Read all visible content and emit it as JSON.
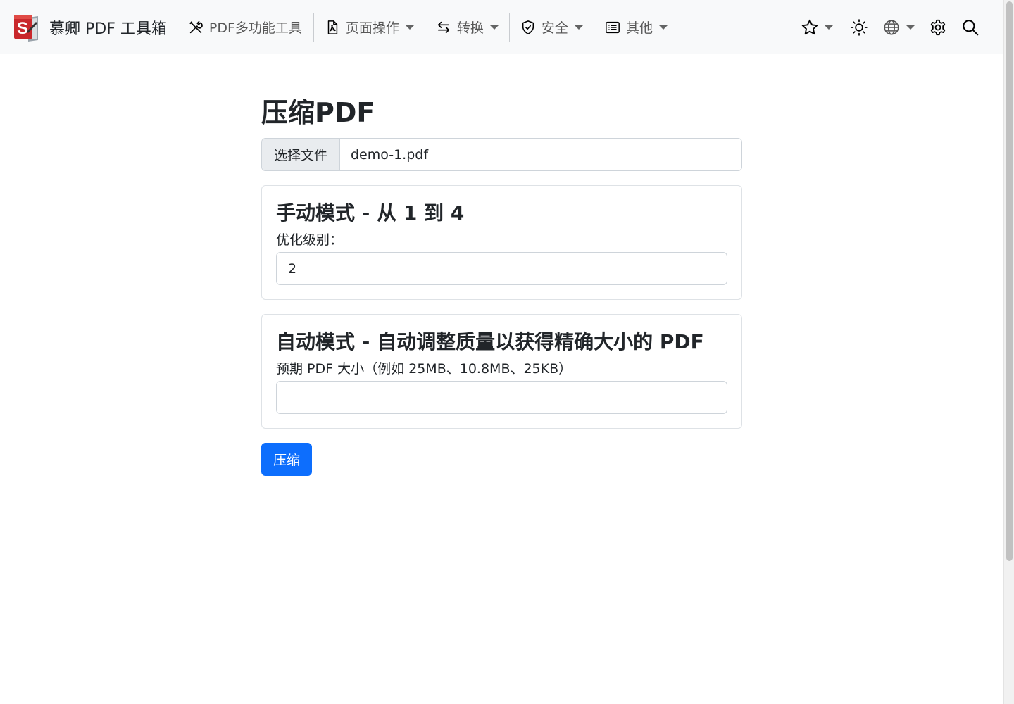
{
  "navbar": {
    "brand_text": "慕卿 PDF 工具箱",
    "multi_tool": "PDF多功能工具",
    "page_ops": "页面操作",
    "convert": "转换",
    "security": "安全",
    "other": "其他",
    "icons": {
      "multi_tool": "tools-icon",
      "page_ops": "file-pdf-icon",
      "convert": "arrows-exchange-icon",
      "security": "shield-icon",
      "other": "list-icon",
      "favorites": "star-icon",
      "theme": "sun-icon",
      "language": "globe-icon",
      "settings": "gear-icon",
      "search": "search-icon"
    }
  },
  "main": {
    "title": "压缩PDF",
    "file_button": "选择文件",
    "file_name": "demo-1.pdf",
    "manual_card": {
      "title": "手动模式 - 从 1 到 4",
      "label": "优化级别：",
      "value": "2"
    },
    "auto_card": {
      "title": "自动模式 - 自动调整质量以获得精确大小的 PDF",
      "label": "预期 PDF 大小（例如 25MB、10.8MB、25KB）",
      "value": ""
    },
    "submit": "压缩"
  },
  "colors": {
    "primary": "#0d6efd",
    "navbar_bg": "#f8f9fa",
    "logo_red": "#c9282c"
  }
}
